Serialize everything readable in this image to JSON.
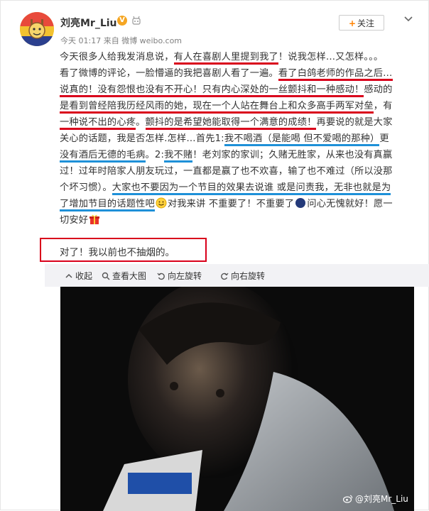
{
  "user": {
    "name": "刘亮Mr_Liu",
    "meta": "今天 01:17 来自 微博 weibo.com",
    "follow_label": "关注"
  },
  "post": {
    "lines": [
      [
        {
          "t": "今天很多人给我发消息说，"
        },
        {
          "t": "有人在喜剧人里提到我了",
          "u": "red"
        },
        {
          "t": "！说我怎样…又怎样。。。"
        }
      ],
      [
        {
          "t": "看了微博的评论，一脸懵逼的我把喜剧人看了一遍。"
        },
        {
          "t": "看了白鸽老师的作品之后…",
          "u": "red"
        }
      ],
      [
        {
          "t": "说真的！没有怨恨也没有不开心！只有",
          "u": "red"
        },
        {
          "t": "内心深处的一丝颤抖和一种感动！",
          "u": "red"
        },
        {
          "t": "感动的"
        }
      ],
      [
        {
          "t": "是看到曾经陪我历经风雨的她，现在一个人站在舞台上和众多高手两军对垒",
          "u": "red"
        },
        {
          "t": "，有"
        }
      ],
      [
        {
          "t": "一种说不出的心疼",
          "u": "red"
        },
        {
          "t": "。"
        },
        {
          "t": "颤抖的是希望她能取得一个满意的成绩！",
          "u": "red"
        },
        {
          "t": "再要说的就是大家"
        }
      ],
      [
        {
          "t": "关心的话题，我是否怎样.怎样…首先1:"
        },
        {
          "t": "我不喝酒（是能喝 但不爱喝的那种）",
          "u": "blue"
        },
        {
          "t": "更"
        }
      ],
      [
        {
          "t": "没有酒后无德的毛病",
          "u": "blue"
        },
        {
          "t": "。2:"
        },
        {
          "t": "我不赌",
          "u": "blue"
        },
        {
          "t": "！老刘家的家训；久赌无胜家，从来也没有真赢"
        }
      ],
      [
        {
          "t": "过！过年时陪家人朋友玩过，一直都是赢了也不欢喜，输了也不难过（所以没那"
        }
      ],
      [
        {
          "t": "个坏习惯）。"
        },
        {
          "t": "大家也不要因为一个节目的效果去说谁 或是问责我，无非也就是为",
          "u": "blue"
        }
      ],
      [
        {
          "t": "了增加节目的话题性吧",
          "u": "blue"
        },
        {
          "e": "smile"
        },
        {
          "t": "对我来讲 不重要了！不重要了"
        },
        {
          "e": "moon"
        },
        {
          "t": "问心无愧就好！愿一"
        }
      ],
      [
        {
          "t": "切安好"
        },
        {
          "e": "gift"
        }
      ]
    ],
    "highlight": "对了！我以前也不抽烟的。"
  },
  "media_bar": {
    "collapse": "收起",
    "view_large": "查看大图",
    "rotate_left": "向左旋转",
    "rotate_right": "向右旋转"
  },
  "photo": {
    "watermark": "@刘亮Mr_Liu"
  },
  "colors": {
    "underline_red": "#d9001b",
    "underline_blue": "#1e90d8",
    "follow_plus": "#ff8200",
    "media_bar_bg": "#f2f2f5"
  }
}
